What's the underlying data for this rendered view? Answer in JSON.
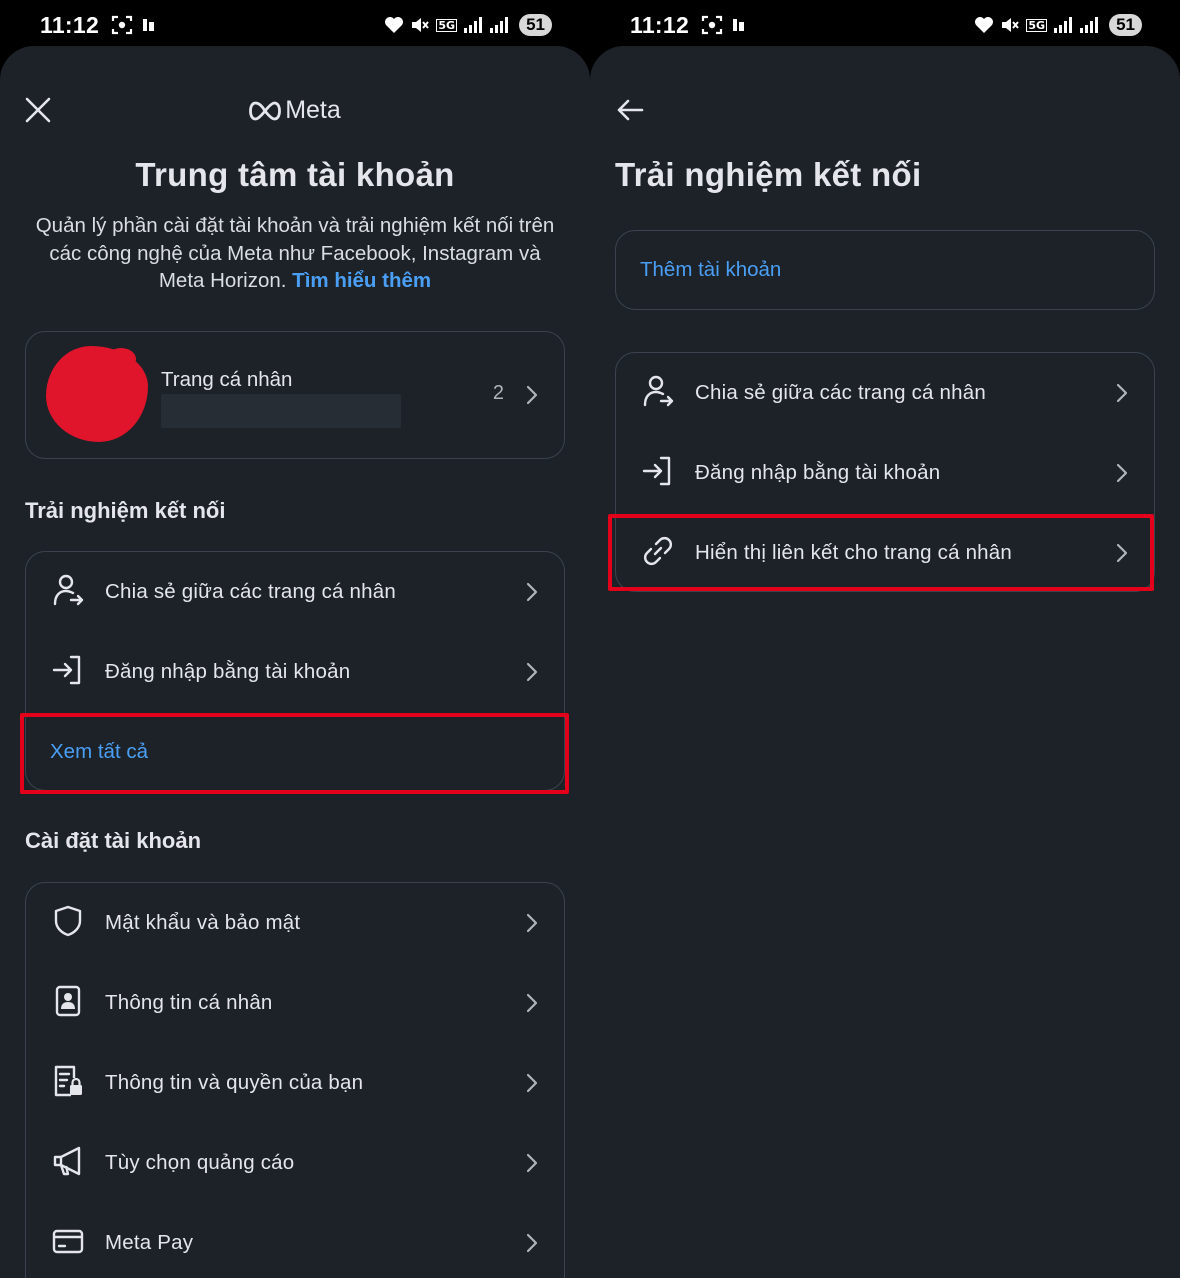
{
  "status_bar": {
    "time": "11:12",
    "network": "5G",
    "battery": "51"
  },
  "left_screen": {
    "brand": "Meta",
    "title": "Trung tâm tài khoản",
    "description": "Quản lý phần cài đặt tài khoản và trải nghiệm kết nối trên các công nghệ của Meta như Facebook, Instagram và Meta Horizon.",
    "learn_more": "Tìm hiểu thêm",
    "profile": {
      "label": "Trang cá nhân",
      "count": "2"
    },
    "connected_section": {
      "title": "Trải nghiệm kết nối",
      "items": [
        {
          "label": "Chia sẻ giữa các trang cá nhân",
          "icon": "share-profile-icon"
        },
        {
          "label": "Đăng nhập bằng tài khoản",
          "icon": "login-icon"
        }
      ],
      "see_all": "Xem tất cả"
    },
    "settings_section": {
      "title": "Cài đặt tài khoản",
      "items": [
        {
          "label": "Mật khẩu và bảo mật",
          "icon": "shield-icon"
        },
        {
          "label": "Thông tin cá nhân",
          "icon": "id-card-icon"
        },
        {
          "label": "Thông tin và quyền của bạn",
          "icon": "document-lock-icon"
        },
        {
          "label": "Tùy chọn quảng cáo",
          "icon": "megaphone-icon"
        },
        {
          "label": "Meta Pay",
          "icon": "credit-card-icon"
        }
      ]
    }
  },
  "right_screen": {
    "title": "Trải nghiệm kết nối",
    "add_account": "Thêm tài khoản",
    "items": [
      {
        "label": "Chia sẻ giữa các trang cá nhân",
        "icon": "share-profile-icon"
      },
      {
        "label": "Đăng nhập bằng tài khoản",
        "icon": "login-icon"
      },
      {
        "label": "Hiển thị liên kết cho trang cá nhân",
        "icon": "link-icon"
      }
    ]
  },
  "colors": {
    "background": "#1c2228",
    "link": "#4a9ff5",
    "highlight": "#e3001b",
    "border": "#3a434d"
  }
}
